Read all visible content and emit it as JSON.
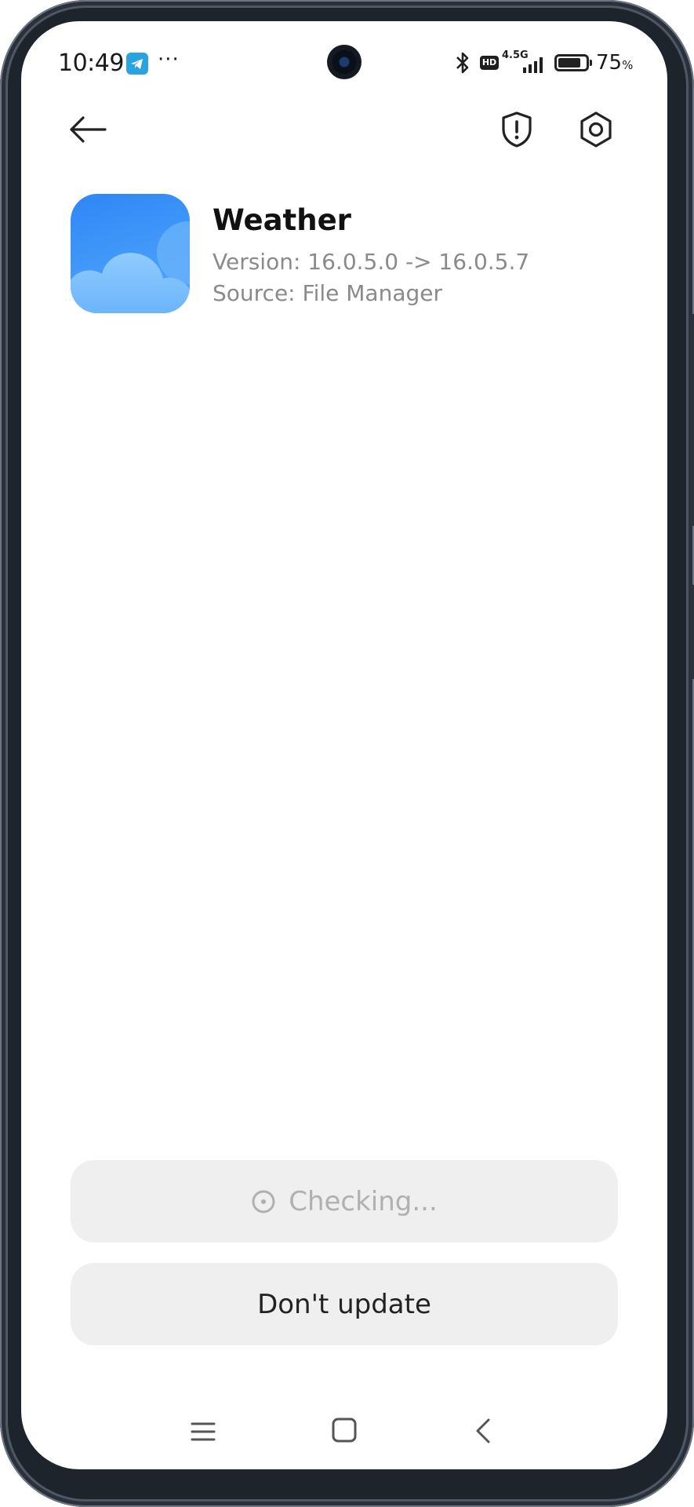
{
  "status_bar": {
    "time": "10:49",
    "more_indicator": "···",
    "hd_label": "HD",
    "network_label": "4.5G",
    "battery_percent": "75",
    "battery_unit": "%",
    "icons": [
      "telegram-icon",
      "bluetooth-icon",
      "signal-icon",
      "battery-icon"
    ]
  },
  "header": {
    "icons": [
      "back-arrow-icon",
      "shield-alert-icon",
      "settings-icon"
    ]
  },
  "app": {
    "name": "Weather",
    "version": "Version: 16.0.5.0 -> 16.0.5.7",
    "source": "Source: File Manager",
    "icon": "weather-cloud-icon",
    "icon_colors": [
      "#2f86f6",
      "#7ec3fb"
    ]
  },
  "actions": {
    "checking_label": "Checking...",
    "dont_update_label": "Don't update"
  },
  "nav": {
    "icons": [
      "menu-icon",
      "home-icon",
      "back-icon"
    ]
  }
}
